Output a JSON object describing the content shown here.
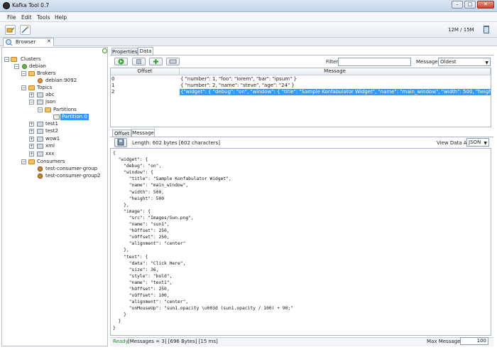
{
  "window": {
    "title": "Kafka Tool  0.7"
  },
  "menu": {
    "file": "File",
    "edit": "Edit",
    "tools": "Tools",
    "help": "Help"
  },
  "toolbar": {
    "memory": "12M / 15M"
  },
  "tabs": {
    "browser": "Browser"
  },
  "tree": {
    "clusters": "Clusters",
    "debian": "debian",
    "brokers": "Brokers",
    "broker1": "debian:9092",
    "topics": "Topics",
    "abc": "abc",
    "json": "json",
    "partitions": "Partitions",
    "partition0": "Partition 0",
    "test1": "test1",
    "test2": "test2",
    "wow1": "wow1",
    "xml": "xml",
    "xxx": "xxx",
    "consumers": "Consumers",
    "group1": "test-consumer-group",
    "group2": "test-consumer-group2"
  },
  "upper_tabs": {
    "properties": "Properties",
    "data": "Data"
  },
  "filter": {
    "label": "Filter",
    "value": "",
    "messages_label": "Messages",
    "messages_value": "Oldest"
  },
  "table": {
    "headers": {
      "offset": "Offset",
      "message": "Message"
    },
    "rows": [
      {
        "offset": "0",
        "message": "{ \"number\": 1, \"foo\": \"lorem\", \"bar\": \"ipsum\" }"
      },
      {
        "offset": "1",
        "message": "{ \"number\": 2, \"name\": \"steve\", \"age\": \"24\" }"
      },
      {
        "offset": "2",
        "message": "{\"widget\": {     \"debug\": \"on\",     \"window\": {         \"title\": \"Sample Konfabulator Widget\",         \"name\": \"main_window\",         \"width\": 500,         \"height\":"
      }
    ]
  },
  "lower_tabs": {
    "offset": "Offset",
    "message": "Message"
  },
  "message_view": {
    "length": "Length: 602 bytes [602 characters]",
    "view_as_label": "View Data As",
    "view_as_value": "JSON",
    "body": "{\n  \"widget\": {\n    \"debug\": \"on\",\n    \"window\": {\n      \"title\": \"Sample Konfabulator Widget\",\n      \"name\": \"main_window\",\n      \"width\": 500,\n      \"height\": 500\n    },\n    \"image\": {\n      \"src\": \"Images/Sun.png\",\n      \"name\": \"sun1\",\n      \"hOffset\": 250,\n      \"vOffset\": 250,\n      \"alignment\": \"center\"\n    },\n    \"text\": {\n      \"data\": \"Click Here\",\n      \"size\": 36,\n      \"style\": \"bold\",\n      \"name\": \"text1\",\n      \"hOffset\": 250,\n      \"vOffset\": 100,\n      \"alignment\": \"center\",\n      \"onMouseUp\": \"sun1.opacity \\u003d (sun1.opacity / 100) + 90;\"\n    }\n  }\n}"
  },
  "status": {
    "ready": "Ready",
    "text": "[Messages = 3]  [696 Bytes]  [15 ms]",
    "max_label": "Max Messages",
    "max_value": "100"
  }
}
